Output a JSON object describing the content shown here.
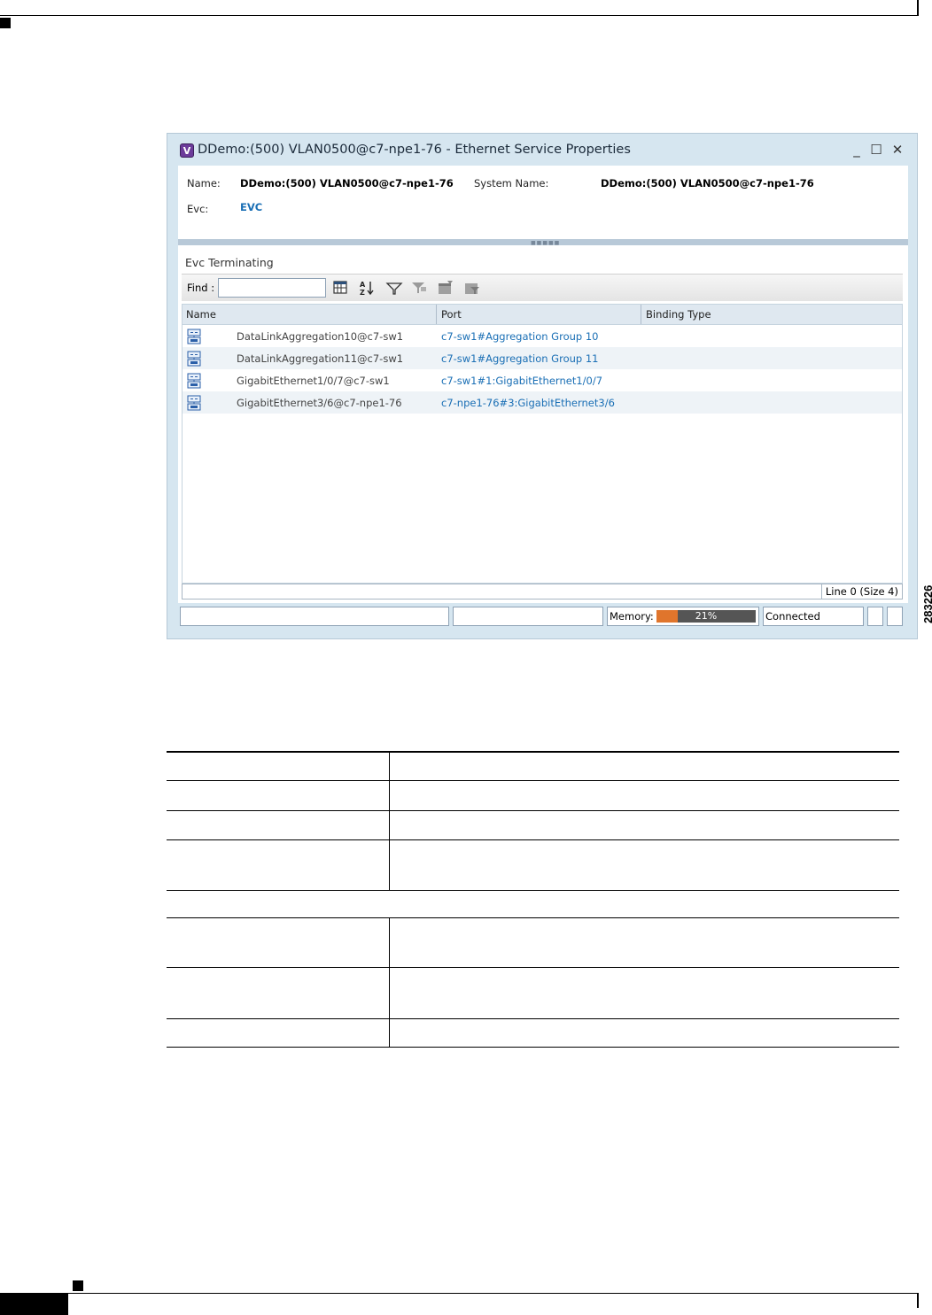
{
  "window": {
    "title": "DDemo:(500) VLAN0500@c7-npe1-76 - Ethernet Service Properties",
    "app_icon": "V",
    "controls": {
      "minimize": "_",
      "maximize": "☐",
      "close": "✕"
    }
  },
  "properties": {
    "name_label": "Name:",
    "name_value": "DDemo:(500) VLAN0500@c7-npe1-76",
    "system_name_label": "System Name:",
    "system_name_value": "DDemo:(500) VLAN0500@c7-npe1-76",
    "evc_label": "Evc:",
    "evc_value": "EVC"
  },
  "section": {
    "title": "Evc Terminating",
    "find_label": "Find :",
    "find_value": "",
    "toolbar_icons": [
      "export-icon",
      "sort-icon",
      "filter-icon",
      "clear-filter-icon",
      "table-settings-icon",
      "column-filter-icon"
    ]
  },
  "grid": {
    "columns": [
      "Name",
      "Port",
      "Binding Type"
    ],
    "rows": [
      {
        "name": "DataLinkAggregation10@c7-sw1",
        "port": "c7-sw1#Aggregation Group 10",
        "binding": ""
      },
      {
        "name": "DataLinkAggregation11@c7-sw1",
        "port": "c7-sw1#Aggregation Group 11",
        "binding": ""
      },
      {
        "name": "GigabitEthernet1/0/7@c7-sw1",
        "port": "c7-sw1#1:GigabitEthernet1/0/7",
        "binding": ""
      },
      {
        "name": "GigabitEthernet3/6@c7-npe1-76",
        "port": "c7-npe1-76#3:GigabitEthernet3/6",
        "binding": ""
      }
    ],
    "line_info": "Line 0 (Size 4)"
  },
  "status": {
    "memory_label": "Memory:",
    "memory_value": "21%",
    "memory_fraction": 0.21,
    "connection": "Connected"
  },
  "figure_number": "283226",
  "colors": {
    "link": "#1a6fb5",
    "memory_fill": "#e0752c",
    "window_bg": "#d6e6f0"
  }
}
